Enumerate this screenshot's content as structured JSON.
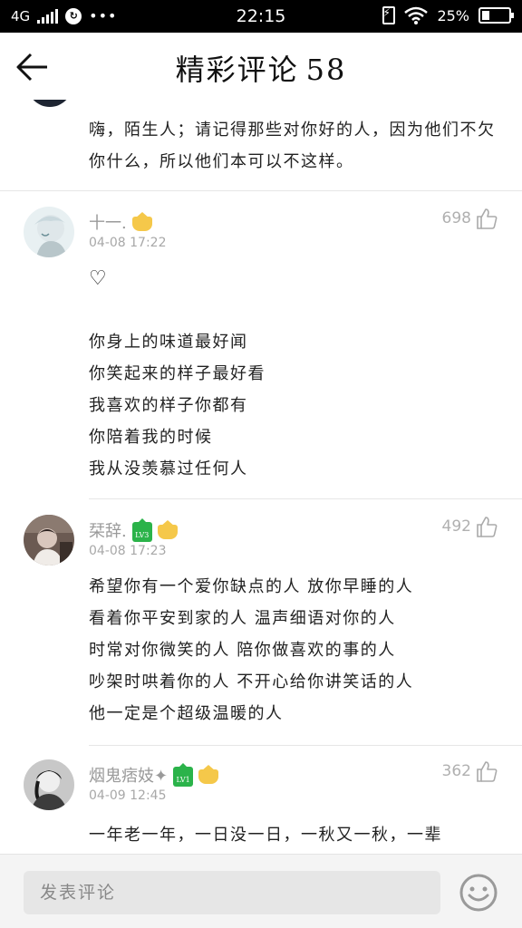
{
  "status_bar": {
    "network": "4G",
    "time": "22:15",
    "battery": "25%"
  },
  "header": {
    "title": "精彩评论",
    "count": "58"
  },
  "top_comment": {
    "text": "嗨，陌生人；请记得那些对你好的人，因为他们不欠你什么，所以他们本可以不这样。"
  },
  "comments": [
    {
      "username": "十一.",
      "date": "04-08 17:22",
      "likes": "698",
      "lines": [
        "♡",
        "",
        "你身上的味道最好闻",
        "你笑起来的样子最好看",
        "我喜欢的样子你都有",
        "你陪着我的时候",
        "我从没羡慕过任何人"
      ]
    },
    {
      "username": "栞辞.",
      "badge_level": "LV3",
      "date": "04-08 17:23",
      "likes": "492",
      "lines": [
        "希望你有一个爱你缺点的人 放你早睡的人",
        "看着你平安到家的人 温声细语对你的人",
        "时常对你微笑的人 陪你做喜欢的事的人",
        "吵架时哄着你的人 不开心给你讲笑话的人",
        "他一定是个超级温暖的人"
      ]
    },
    {
      "username": "烟鬼痞妓✦",
      "badge_level": "LV1",
      "date": "04-09 12:45",
      "likes": "362",
      "lines": [
        "一年老一年，一日没一日，一秋又一秋，一辈"
      ]
    }
  ],
  "input": {
    "placeholder": "发表评论"
  },
  "icons": {
    "back": "back-arrow-icon",
    "like": "thumb-up-icon",
    "emoji": "smiley-icon",
    "wifi": "wifi-icon",
    "charging": "charging-icon"
  }
}
